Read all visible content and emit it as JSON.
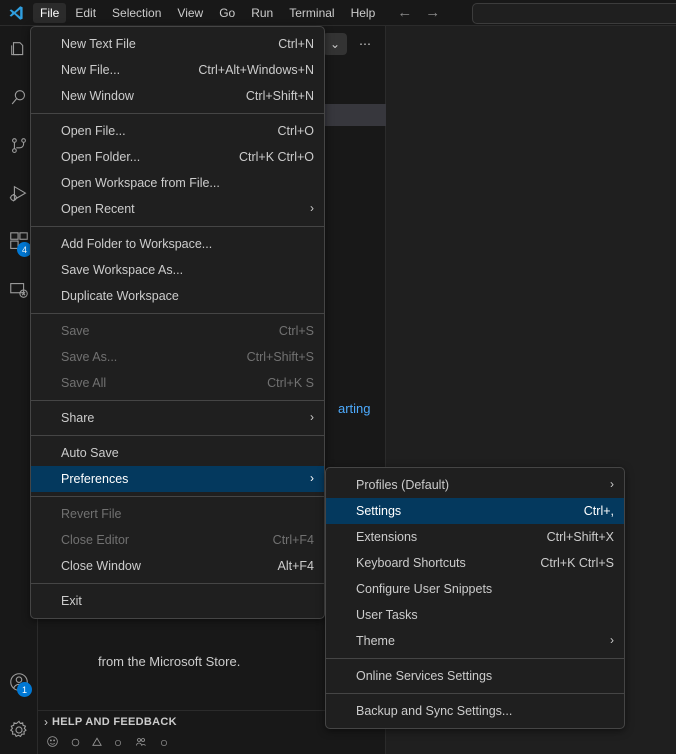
{
  "titlebar": {
    "logo_icon": "vscode-logo",
    "menus": [
      "File",
      "Edit",
      "Selection",
      "View",
      "Go",
      "Run",
      "Terminal",
      "Help"
    ],
    "active_menu": "File",
    "back_icon": "arrow-left-icon",
    "forward_icon": "arrow-right-icon",
    "command_center_value": ""
  },
  "activitybar": {
    "items": [
      {
        "name": "explorer",
        "icon": "files-icon",
        "badge": ""
      },
      {
        "name": "search",
        "icon": "search-icon",
        "badge": ""
      },
      {
        "name": "source-control",
        "icon": "source-control-icon",
        "badge": ""
      },
      {
        "name": "run-and-debug",
        "icon": "run-debug-icon",
        "badge": ""
      },
      {
        "name": "extensions",
        "icon": "extensions-icon",
        "badge": "4"
      },
      {
        "name": "remote-explorer",
        "icon": "remote-explorer-icon",
        "badge": ""
      }
    ],
    "bottom": [
      {
        "name": "accounts",
        "icon": "account-icon",
        "badge": "1"
      },
      {
        "name": "manage",
        "icon": "gear-icon",
        "badge": ""
      }
    ],
    "badge_color": "#0078d4"
  },
  "sidebar": {
    "header_actions": [
      {
        "name": "chevron-down",
        "icon": "chevron-down-icon",
        "glyph": "⌄",
        "selected": true
      },
      {
        "name": "more-actions",
        "icon": "ellipsis-icon",
        "glyph": "⋯",
        "selected": false
      }
    ],
    "selected_row_icon": "new-file-icon",
    "welcome_link_text": "arting",
    "store_text": "from the Microsoft Store.",
    "section_label": "HELP AND FEEDBACK",
    "section_chevron": "›"
  },
  "file_menu": {
    "groups": [
      [
        {
          "label": "New Text File",
          "keybinding": "Ctrl+N",
          "state": "normal",
          "submenu": false
        },
        {
          "label": "New File...",
          "keybinding": "Ctrl+Alt+Windows+N",
          "state": "normal",
          "submenu": false
        },
        {
          "label": "New Window",
          "keybinding": "Ctrl+Shift+N",
          "state": "normal",
          "submenu": false
        }
      ],
      [
        {
          "label": "Open File...",
          "keybinding": "Ctrl+O",
          "state": "normal",
          "submenu": false
        },
        {
          "label": "Open Folder...",
          "keybinding": "Ctrl+K Ctrl+O",
          "state": "normal",
          "submenu": false
        },
        {
          "label": "Open Workspace from File...",
          "keybinding": "",
          "state": "normal",
          "submenu": false
        },
        {
          "label": "Open Recent",
          "keybinding": "",
          "state": "normal",
          "submenu": true
        }
      ],
      [
        {
          "label": "Add Folder to Workspace...",
          "keybinding": "",
          "state": "normal",
          "submenu": false
        },
        {
          "label": "Save Workspace As...",
          "keybinding": "",
          "state": "normal",
          "submenu": false
        },
        {
          "label": "Duplicate Workspace",
          "keybinding": "",
          "state": "normal",
          "submenu": false
        }
      ],
      [
        {
          "label": "Save",
          "keybinding": "Ctrl+S",
          "state": "disabled",
          "submenu": false
        },
        {
          "label": "Save As...",
          "keybinding": "Ctrl+Shift+S",
          "state": "disabled",
          "submenu": false
        },
        {
          "label": "Save All",
          "keybinding": "Ctrl+K S",
          "state": "disabled",
          "submenu": false
        }
      ],
      [
        {
          "label": "Share",
          "keybinding": "",
          "state": "normal",
          "submenu": true
        }
      ],
      [
        {
          "label": "Auto Save",
          "keybinding": "",
          "state": "normal",
          "submenu": false
        },
        {
          "label": "Preferences",
          "keybinding": "",
          "state": "highlight",
          "submenu": true
        }
      ],
      [
        {
          "label": "Revert File",
          "keybinding": "",
          "state": "disabled",
          "submenu": false
        },
        {
          "label": "Close Editor",
          "keybinding": "Ctrl+F4",
          "state": "disabled",
          "submenu": false
        },
        {
          "label": "Close Window",
          "keybinding": "Alt+F4",
          "state": "normal",
          "submenu": false
        }
      ],
      [
        {
          "label": "Exit",
          "keybinding": "",
          "state": "normal",
          "submenu": false
        }
      ]
    ]
  },
  "preferences_menu": {
    "groups": [
      [
        {
          "label": "Profiles (Default)",
          "keybinding": "",
          "state": "normal",
          "submenu": true
        },
        {
          "label": "Settings",
          "keybinding": "Ctrl+,",
          "state": "highlight",
          "submenu": false
        },
        {
          "label": "Extensions",
          "keybinding": "Ctrl+Shift+X",
          "state": "normal",
          "submenu": false
        },
        {
          "label": "Keyboard Shortcuts",
          "keybinding": "Ctrl+K Ctrl+S",
          "state": "normal",
          "submenu": false
        },
        {
          "label": "Configure User Snippets",
          "keybinding": "",
          "state": "normal",
          "submenu": false
        },
        {
          "label": "User Tasks",
          "keybinding": "",
          "state": "normal",
          "submenu": false
        },
        {
          "label": "Theme",
          "keybinding": "",
          "state": "normal",
          "submenu": true
        }
      ],
      [
        {
          "label": "Online Services Settings",
          "keybinding": "",
          "state": "normal",
          "submenu": false
        }
      ],
      [
        {
          "label": "Backup and Sync Settings...",
          "keybinding": "",
          "state": "normal",
          "submenu": false
        }
      ]
    ]
  },
  "colors": {
    "menu_bg": "#1f1f1f",
    "menu_border": "#454545",
    "highlight_bg": "#04395e",
    "accent": "#0078d4",
    "link": "#4daafc"
  }
}
